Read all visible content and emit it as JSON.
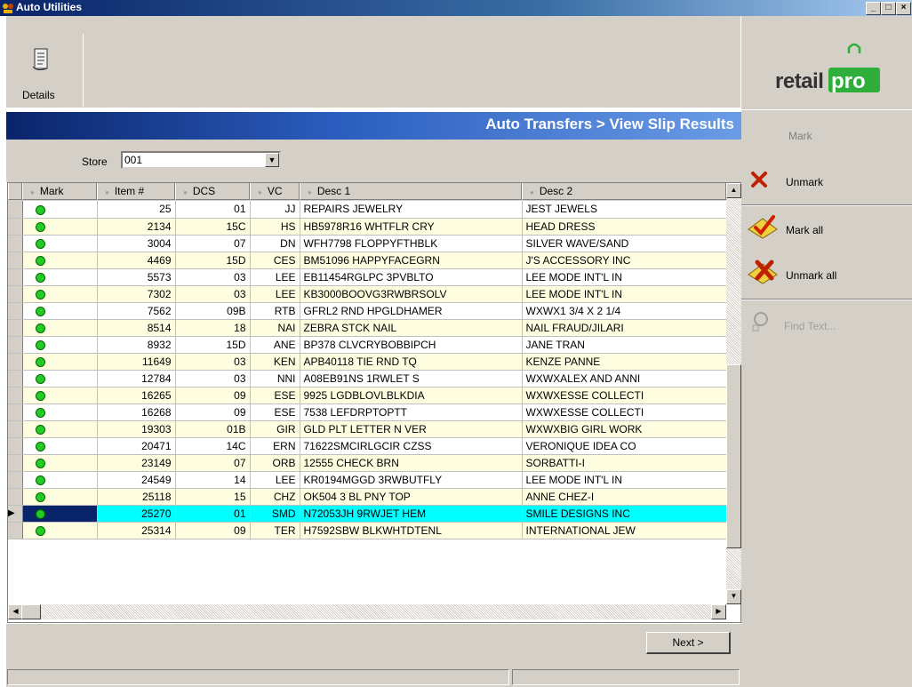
{
  "window": {
    "title": "Auto Utilities",
    "controls": [
      "minimize",
      "maximize",
      "close"
    ]
  },
  "toolbar": {
    "details_label": "Details"
  },
  "header": {
    "breadcrumb": "Auto Transfers > View Slip Results"
  },
  "filter": {
    "store_label": "Store",
    "store_value": "001"
  },
  "grid": {
    "columns": [
      "Mark",
      "Item #",
      "DCS",
      "VC",
      "Desc 1",
      "Desc 2"
    ],
    "rows": [
      {
        "item": "25",
        "dcs": "01",
        "vc": "JJ",
        "desc1": "REPAIRS JEWELRY",
        "desc2": "JEST JEWELS"
      },
      {
        "item": "2134",
        "dcs": "15C",
        "vc": "HS",
        "desc1": "HB5978R16 WHTFLR CRY",
        "desc2": "HEAD DRESS"
      },
      {
        "item": "3004",
        "dcs": "07",
        "vc": "DN",
        "desc1": "WFH7798 FLOPPYFTHBLK",
        "desc2": "SILVER WAVE/SAND"
      },
      {
        "item": "4469",
        "dcs": "15D",
        "vc": "CES",
        "desc1": "BM51096 HAPPYFACEGRN",
        "desc2": "J'S ACCESSORY INC"
      },
      {
        "item": "5573",
        "dcs": "03",
        "vc": "LEE",
        "desc1": "EB11454RGLPC 3PVBLTO",
        "desc2": "LEE MODE INT'L IN"
      },
      {
        "item": "7302",
        "dcs": "03",
        "vc": "LEE",
        "desc1": "KB3000BOOVG3RWBRSOLV",
        "desc2": "LEE MODE INT'L IN"
      },
      {
        "item": "7562",
        "dcs": "09B",
        "vc": "RTB",
        "desc1": "GFRL2 RND HPGLDHAMER",
        "desc2": "WXWX1 3/4 X 2 1/4"
      },
      {
        "item": "8514",
        "dcs": "18",
        "vc": "NAI",
        "desc1": "ZEBRA STCK NAIL",
        "desc2": "NAIL FRAUD/JILARI"
      },
      {
        "item": "8932",
        "dcs": "15D",
        "vc": "ANE",
        "desc1": "BP378 CLVCRYBOBBIPCH",
        "desc2": "JANE TRAN"
      },
      {
        "item": "11649",
        "dcs": "03",
        "vc": "KEN",
        "desc1": "APB40118 TIE RND TQ",
        "desc2": "KENZE PANNE"
      },
      {
        "item": "12784",
        "dcs": "03",
        "vc": "NNI",
        "desc1": "A08EB91NS 1RWLET S",
        "desc2": "WXWXALEX AND ANNI"
      },
      {
        "item": "16265",
        "dcs": "09",
        "vc": "ESE",
        "desc1": "9925 LGDBLOVLBLKDIA",
        "desc2": "WXWXESSE COLLECTI"
      },
      {
        "item": "16268",
        "dcs": "09",
        "vc": "ESE",
        "desc1": "7538 LEFDRPTOPTT",
        "desc2": "WXWXESSE COLLECTI"
      },
      {
        "item": "19303",
        "dcs": "01B",
        "vc": "GIR",
        "desc1": "GLD PLT LETTER N VER",
        "desc2": "WXWXBIG GIRL WORK"
      },
      {
        "item": "20471",
        "dcs": "14C",
        "vc": "ERN",
        "desc1": "71622SMCIRLGCIR CZSS",
        "desc2": "VERONIQUE IDEA CO"
      },
      {
        "item": "23149",
        "dcs": "07",
        "vc": "ORB",
        "desc1": "12555 CHECK BRN",
        "desc2": "SORBATTI-I"
      },
      {
        "item": "24549",
        "dcs": "14",
        "vc": "LEE",
        "desc1": "KR0194MGGD 3RWBUTFLY",
        "desc2": "LEE MODE INT'L IN"
      },
      {
        "item": "25118",
        "dcs": "15",
        "vc": "CHZ",
        "desc1": "OK504 3 BL PNY TOP",
        "desc2": "ANNE CHEZ-I"
      },
      {
        "item": "25270",
        "dcs": "01",
        "vc": "SMD",
        "desc1": "N72053JH 9RWJET HEM",
        "desc2": "SMILE DESIGNS INC",
        "selected": true
      },
      {
        "item": "25314",
        "dcs": "09",
        "vc": "TER",
        "desc1": "H7592SBW BLKWHTDTENL",
        "desc2": "INTERNATIONAL JEW"
      }
    ]
  },
  "footer": {
    "next_label": "Next >"
  },
  "sidebar": {
    "logo_left": "retail",
    "logo_right": "pro",
    "mark_label": "Mark",
    "unmark_label": "Unmark",
    "mark_all_label": "Mark all",
    "unmark_all_label": "Unmark all",
    "find_text_label": "Find Text..."
  },
  "colors": {
    "selected_row": "#00ffff",
    "alt_row": "#fffde0",
    "mark_dot": "#22cc22",
    "brand_green": "#2fae3b"
  }
}
